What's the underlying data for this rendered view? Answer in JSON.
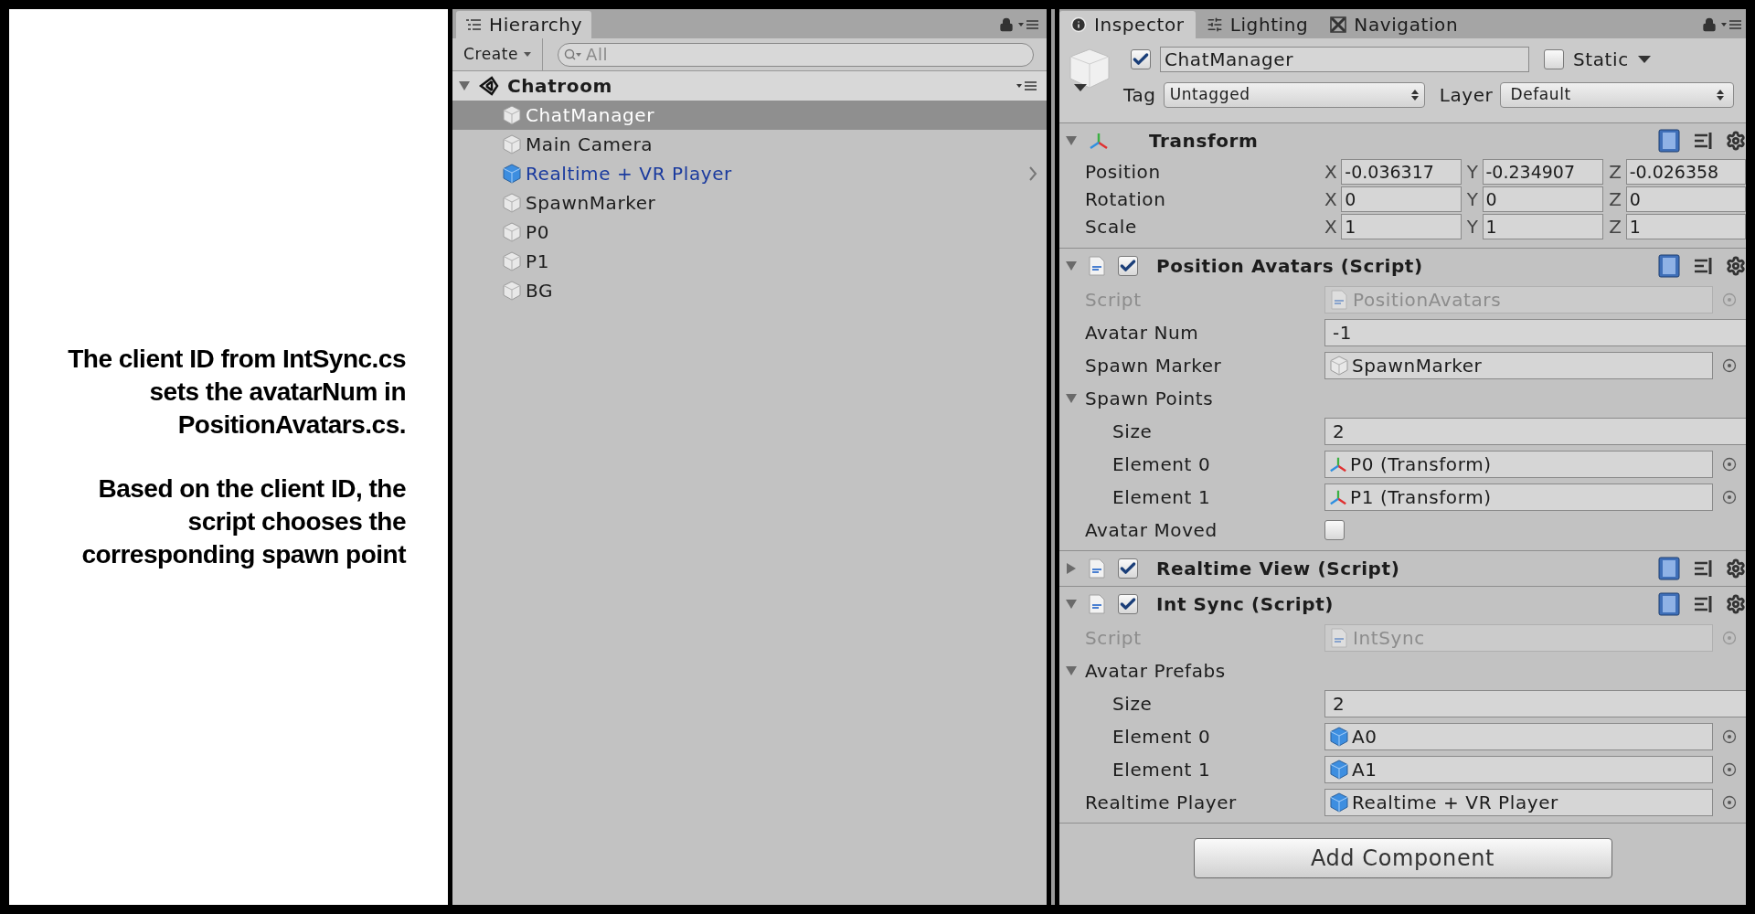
{
  "annotation": {
    "paragraphs": [
      "The client ID from IntSync.cs sets the avatarNum in PositionAvatars.cs.",
      "Based on the client ID, the script chooses the corresponding spawn point"
    ]
  },
  "hierarchy": {
    "tab": "Hierarchy",
    "create": "Create",
    "search_placeholder": "All",
    "scene": {
      "name": "Chatroom",
      "expanded": true,
      "children": [
        {
          "name": "ChatManager",
          "kind": "object",
          "selected": true,
          "has_children": false
        },
        {
          "name": "Main Camera",
          "kind": "object",
          "selected": false,
          "has_children": false
        },
        {
          "name": "Realtime + VR Player",
          "kind": "prefab",
          "selected": false,
          "has_children": true
        },
        {
          "name": "SpawnMarker",
          "kind": "object",
          "selected": false,
          "has_children": false
        },
        {
          "name": "P0",
          "kind": "object",
          "selected": false,
          "has_children": false
        },
        {
          "name": "P1",
          "kind": "object",
          "selected": false,
          "has_children": false
        },
        {
          "name": "BG",
          "kind": "object",
          "selected": false,
          "has_children": false
        }
      ]
    }
  },
  "inspector": {
    "tabs": [
      {
        "label": "Inspector",
        "selected": true
      },
      {
        "label": "Lighting",
        "selected": false
      },
      {
        "label": "Navigation",
        "selected": false
      }
    ],
    "object": {
      "active": true,
      "name": "ChatManager",
      "static_label": "Static",
      "static": false,
      "tag_label": "Tag",
      "tag": "Untagged",
      "layer_label": "Layer",
      "layer": "Default"
    },
    "components": [
      {
        "kind": "transform",
        "title": "Transform",
        "expanded": true,
        "rows": [
          {
            "label": "Position",
            "values": [
              {
                "axis": "X",
                "value": "-0.036317"
              },
              {
                "axis": "Y",
                "value": "-0.234907"
              },
              {
                "axis": "Z",
                "value": "-0.026358"
              }
            ]
          },
          {
            "label": "Rotation",
            "values": [
              {
                "axis": "X",
                "value": "0"
              },
              {
                "axis": "Y",
                "value": "0"
              },
              {
                "axis": "Z",
                "value": "0"
              }
            ]
          },
          {
            "label": "Scale",
            "values": [
              {
                "axis": "X",
                "value": "1"
              },
              {
                "axis": "Y",
                "value": "1"
              },
              {
                "axis": "Z",
                "value": "1"
              }
            ]
          }
        ]
      },
      {
        "kind": "script",
        "title": "Position Avatars (Script)",
        "enabled": true,
        "expanded": true,
        "fields": [
          {
            "kind": "script",
            "label": "Script",
            "value": "PositionAvatars"
          },
          {
            "kind": "text",
            "label": "Avatar Num",
            "value": "-1"
          },
          {
            "kind": "gameobject_ref",
            "label": "Spawn Marker",
            "value": "SpawnMarker"
          },
          {
            "kind": "foldout",
            "label": "Spawn Points",
            "expanded": true,
            "children": [
              {
                "kind": "text",
                "label": "Size",
                "value": "2"
              },
              {
                "kind": "transform_ref",
                "label": "Element 0",
                "value": "P0 (Transform)"
              },
              {
                "kind": "transform_ref",
                "label": "Element 1",
                "value": "P1 (Transform)"
              }
            ]
          },
          {
            "kind": "checkbox",
            "label": "Avatar Moved",
            "checked": false
          }
        ]
      },
      {
        "kind": "script",
        "title": "Realtime View (Script)",
        "enabled": true,
        "expanded": false
      },
      {
        "kind": "script",
        "title": "Int Sync (Script)",
        "enabled": true,
        "expanded": true,
        "fields": [
          {
            "kind": "script",
            "label": "Script",
            "value": "IntSync"
          },
          {
            "kind": "foldout",
            "label": "Avatar Prefabs",
            "expanded": true,
            "children": [
              {
                "kind": "text",
                "label": "Size",
                "value": "2"
              },
              {
                "kind": "prefab_ref",
                "label": "Element 0",
                "value": "A0"
              },
              {
                "kind": "prefab_ref",
                "label": "Element 1",
                "value": "A1"
              }
            ]
          },
          {
            "kind": "prefab_ref",
            "label": "Realtime Player",
            "value": "Realtime + VR Player"
          }
        ]
      }
    ],
    "add_component": "Add Component"
  }
}
